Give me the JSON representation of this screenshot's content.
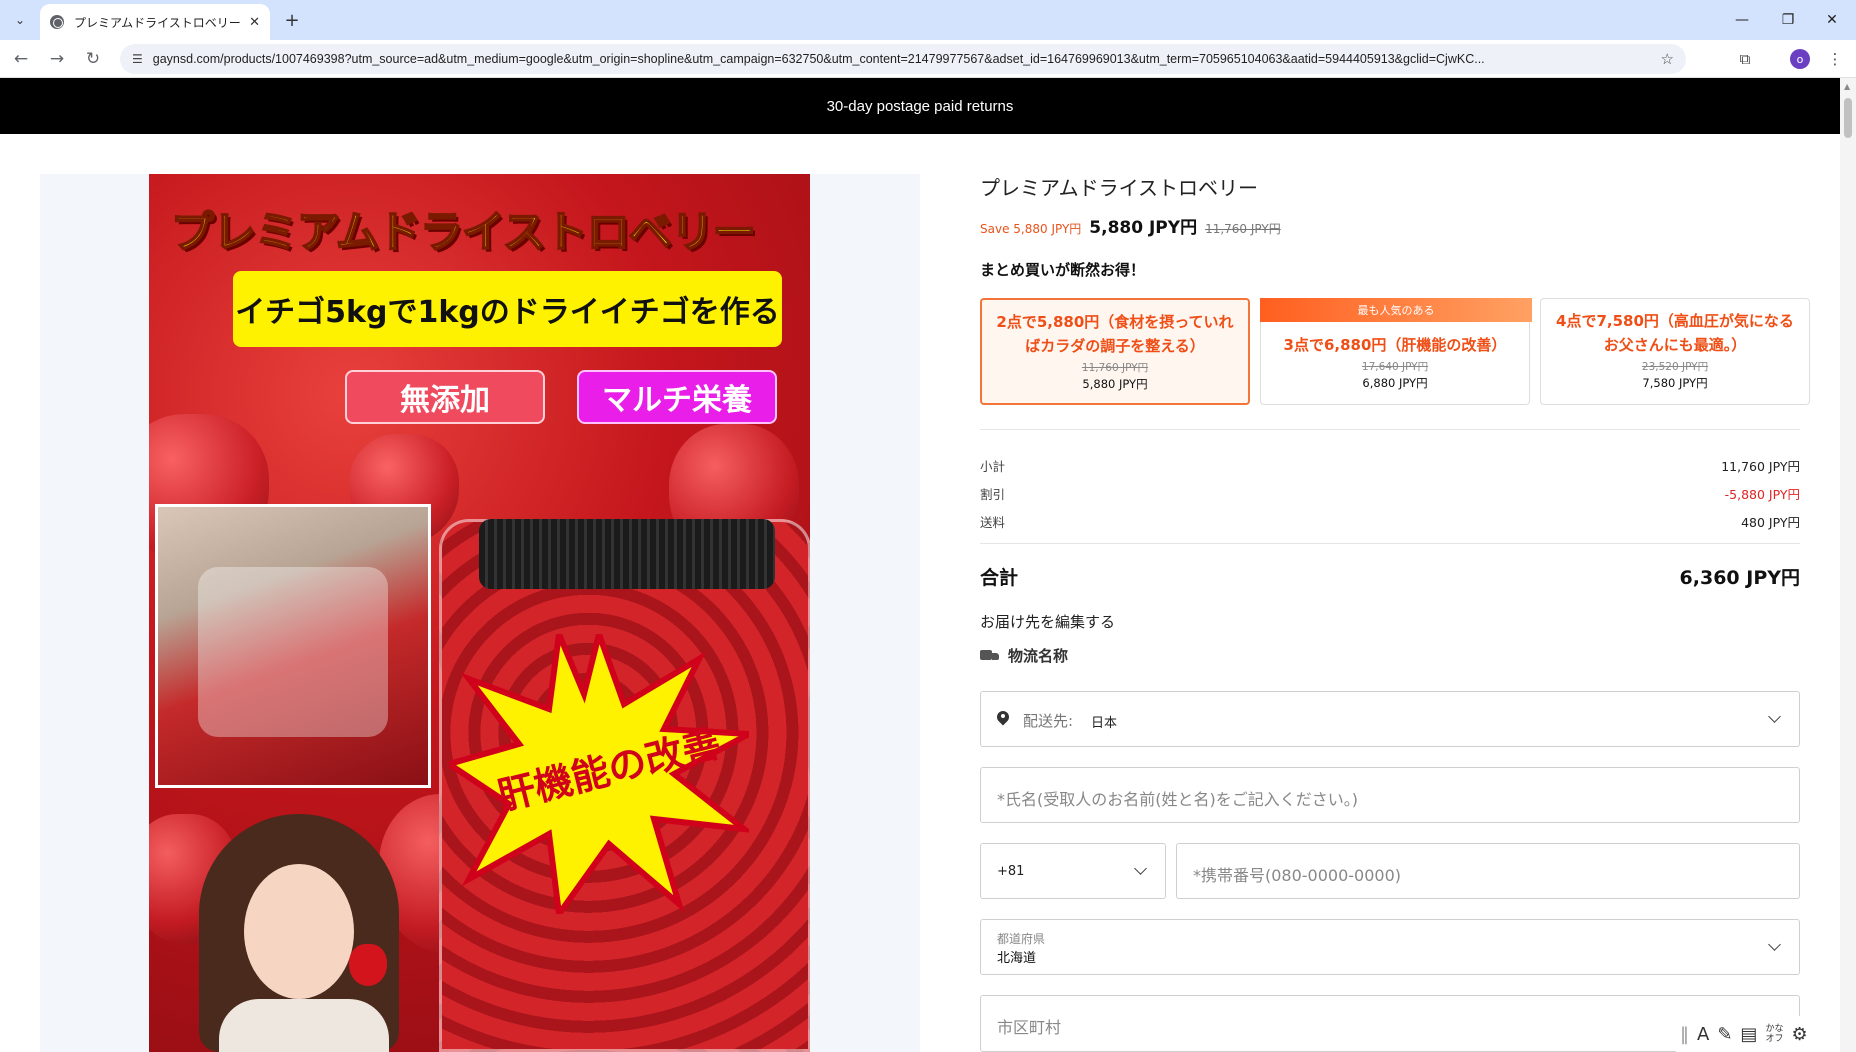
{
  "browser": {
    "tab_title": "プレミアムドライストロベリー – gaynsd",
    "url": "gaynsd.com/products/1007469398?utm_source=ad&utm_medium=google&utm_origin=shopline&utm_campaign=632750&utm_content=21479977567&adset_id=164769969013&utm_term=705965104063&aatid=5944405913&gclid=CjwKC...",
    "profile_initial": "o"
  },
  "announcement": "30-day postage paid returns",
  "hero": {
    "title": "プレミアムドライストロベリー",
    "subtitle": "イチゴ5kgで1kgのドライイチゴを作る",
    "pill_left": "無添加",
    "pill_right": "マルチ栄養",
    "burst_text": "肝機能の改善"
  },
  "product": {
    "title": "プレミアムドライストロベリー",
    "save": "Save 5,880 JPY円",
    "price": "5,880 JPY円",
    "compare_price": "11,760 JPY円",
    "bulk_label": "まとめ買いが断然お得！",
    "offers": [
      {
        "name": "2点で5,880円（食材を摂っていればカラダの調子を整える）",
        "compare": "11,760 JPY円",
        "price": "5,880 JPY円",
        "badge": ""
      },
      {
        "name": "3点で6,880円（肝機能の改善）",
        "compare": "17,640 JPY円",
        "price": "6,880 JPY円",
        "badge": "最も人気のある"
      },
      {
        "name": "4点で7,580円（高血圧が気になるお父さんにも最適。）",
        "compare": "23,520 JPY円",
        "price": "7,580 JPY円",
        "badge": ""
      }
    ]
  },
  "summary": {
    "subtotal_label": "小計",
    "subtotal": "11,760 JPY円",
    "discount_label": "割引",
    "discount": "-5,880 JPY円",
    "shipping_label": "送料",
    "shipping": "480 JPY円",
    "total_label": "合計",
    "total": "6,360 JPY円"
  },
  "shipping_form": {
    "edit_label": "お届け先を編集する",
    "carrier_label": "物流名称",
    "destination_label": "配送先:",
    "destination_value": "日本",
    "name_placeholder": "*氏名(受取人のお名前(姓と名)をご記入ください。)",
    "country_code": "+81",
    "phone_placeholder": "*携帯番号(080-0000-0000)",
    "prefecture_label": "都道府県",
    "prefecture_value": "北海道",
    "city_placeholder": "市区町村"
  },
  "ime_tray": {
    "mode": "A",
    "kana_top": "かな",
    "kana_bottom": "オフ"
  },
  "colors": {
    "accent": "#ef4f17",
    "discount": "#e02424",
    "announce_bg": "#000000"
  }
}
